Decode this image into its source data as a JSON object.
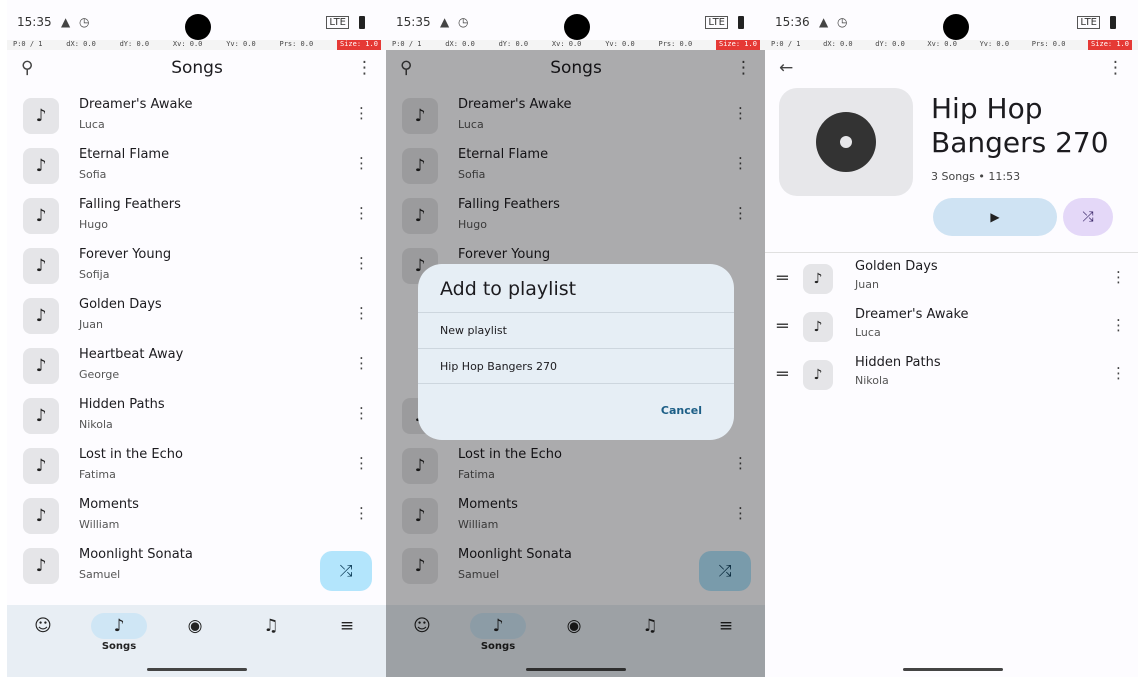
{
  "panel1": {
    "status": {
      "time": "15:35",
      "network": "LTE"
    },
    "debug": {
      "p": "P:0 / 1",
      "dx": "dX: 0.0",
      "dy": "dY: 0.0",
      "xv": "Xv: 0.0",
      "yv": "Yv: 0.0",
      "prs": "Prs: 0.0",
      "size": "Size: 1.0"
    },
    "title": "Songs",
    "songs": [
      {
        "title": "Dreamer's Awake",
        "artist": "Luca"
      },
      {
        "title": "Eternal Flame",
        "artist": "Sofia"
      },
      {
        "title": "Falling Feathers",
        "artist": "Hugo"
      },
      {
        "title": "Forever Young",
        "artist": "Sofija"
      },
      {
        "title": "Golden Days",
        "artist": "Juan"
      },
      {
        "title": "Heartbeat Away",
        "artist": "George"
      },
      {
        "title": "Hidden Paths",
        "artist": "Nikola"
      },
      {
        "title": "Lost in the Echo",
        "artist": "Fatima"
      },
      {
        "title": "Moments",
        "artist": "William"
      },
      {
        "title": "Moonlight Sonata",
        "artist": "Samuel"
      }
    ],
    "nav": {
      "active_label": "Songs"
    }
  },
  "panel2": {
    "status": {
      "time": "15:35",
      "network": "LTE"
    },
    "debug": {
      "p": "P:0 / 1",
      "dx": "dX: 0.0",
      "dy": "dY: 0.0",
      "xv": "Xv: 0.0",
      "yv": "Yv: 0.0",
      "prs": "Prs: 0.0",
      "size": "Size: 1.0"
    },
    "title": "Songs",
    "dialog": {
      "title": "Add to playlist",
      "options": [
        "New playlist",
        "Hip Hop Bangers 270"
      ],
      "cancel": "Cancel"
    }
  },
  "panel3": {
    "status": {
      "time": "15:36",
      "network": "LTE"
    },
    "debug": {
      "p": "P:0 / 1",
      "dx": "dX: 0.0",
      "dy": "dY: 0.0",
      "xv": "Xv: 0.0",
      "yv": "Yv: 0.0",
      "prs": "Prs: 0.0",
      "size": "Size: 1.0"
    },
    "playlist": {
      "title": "Hip Hop Bangers 270",
      "meta": "3 Songs • 11:53"
    },
    "songs": [
      {
        "title": "Golden Days",
        "artist": "Juan"
      },
      {
        "title": "Dreamer's Awake",
        "artist": "Luca"
      },
      {
        "title": "Hidden Paths",
        "artist": "Nikola"
      }
    ]
  },
  "colors": {
    "accent": "#b3e5fc",
    "nav_bg": "#e8eef4",
    "dialog_bg": "#e6eef5"
  }
}
